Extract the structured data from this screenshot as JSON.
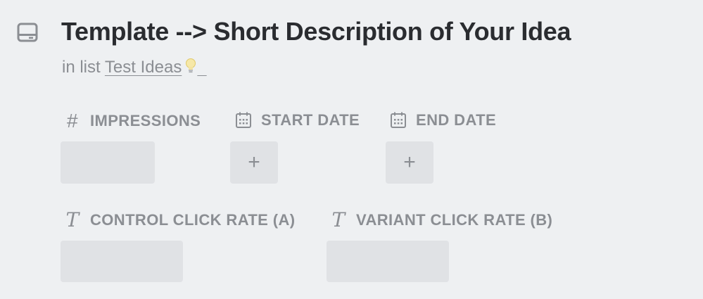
{
  "card": {
    "icon": "card-icon",
    "title": "Template --> Short Description of Your Idea",
    "list_prefix": "in list",
    "list_name": "Test Ideas",
    "list_emoji_icon": "lightbulb-icon"
  },
  "fields": {
    "impressions": {
      "label": "IMPRESSIONS",
      "icon": "hash-icon",
      "value": ""
    },
    "start_date": {
      "label": "START DATE",
      "icon": "calendar-icon",
      "button_glyph": "+"
    },
    "end_date": {
      "label": "END DATE",
      "icon": "calendar-icon",
      "button_glyph": "+"
    },
    "control_click_rate": {
      "label": "CONTROL CLICK RATE (A)",
      "icon": "text-icon",
      "value": ""
    },
    "variant_click_rate": {
      "label": "VARIANT CLICK RATE (B)",
      "icon": "text-icon",
      "value": ""
    }
  },
  "colors": {
    "background": "#eef0f2",
    "title": "#2a2c30",
    "muted_text": "#8b8e93",
    "field_box": "#e0e2e5"
  }
}
